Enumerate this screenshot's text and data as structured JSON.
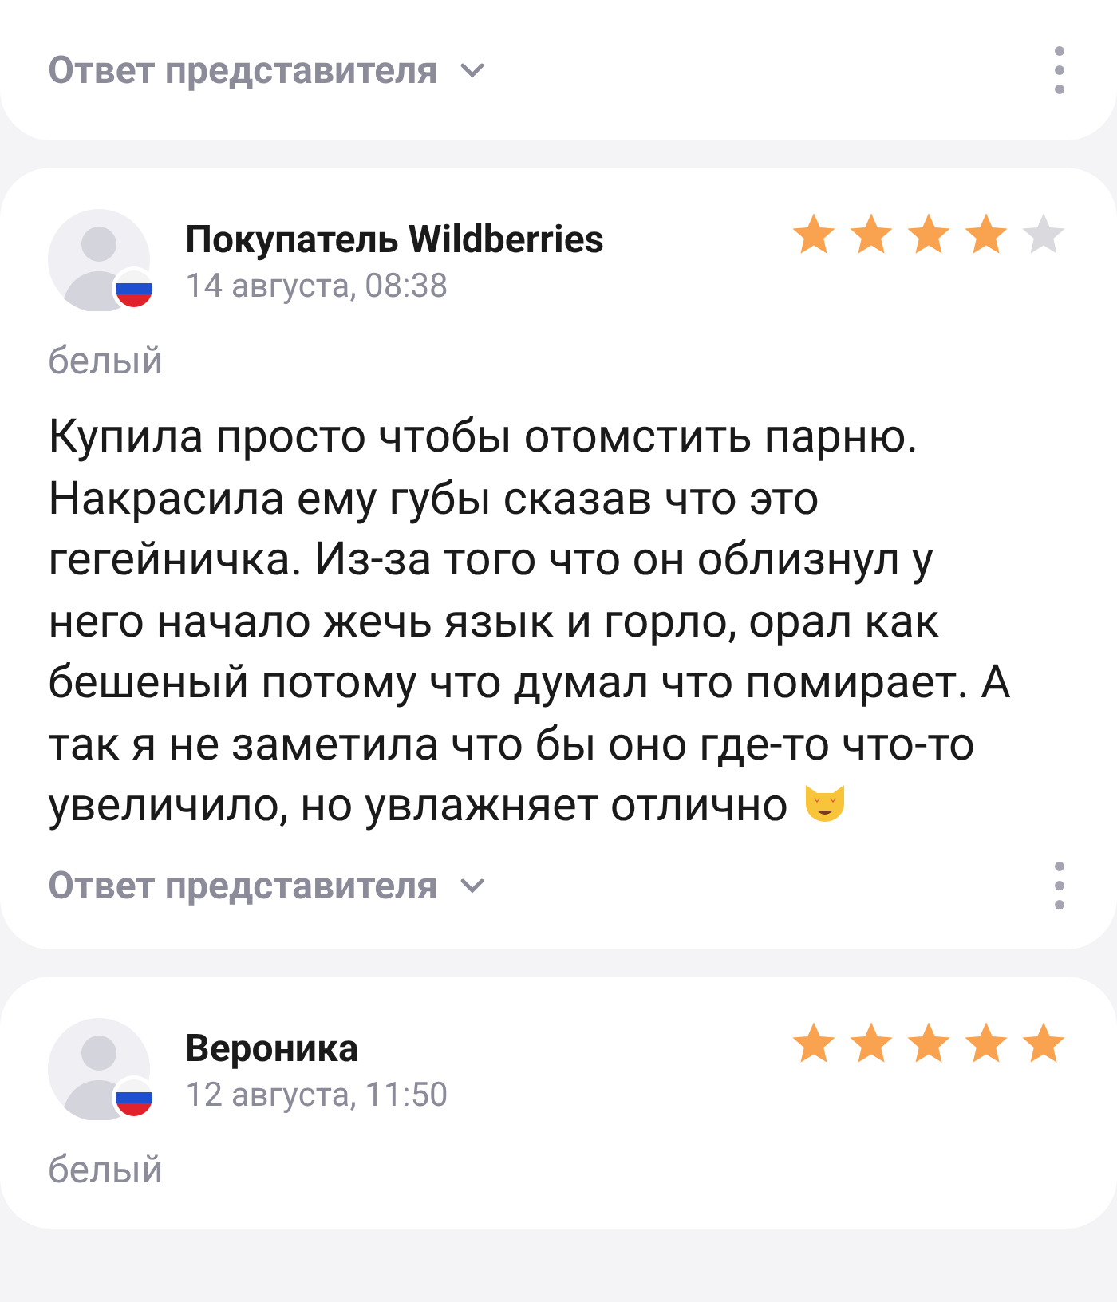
{
  "reviews": [
    {
      "reply_toggle": "Ответ представителя"
    },
    {
      "author": "Покупатель Wildberries",
      "date": "14 августа, 08:38",
      "stars": 4,
      "color_option": "белый",
      "text": "Купила просто чтобы отомстить парню. Накрасила ему губы сказав что это гегейничка. Из-за того что он облизнул у него начало жечь язык и горло, орал как бешеный потому что думал что помирает. А так я не заметила что бы оно где-то что-то увеличило, но увлажняет отлично",
      "emoji": true,
      "reply_toggle": "Ответ представителя"
    },
    {
      "author": "Вероника",
      "date": "12 августа, 11:50",
      "stars": 5,
      "color_option": "белый"
    }
  ]
}
